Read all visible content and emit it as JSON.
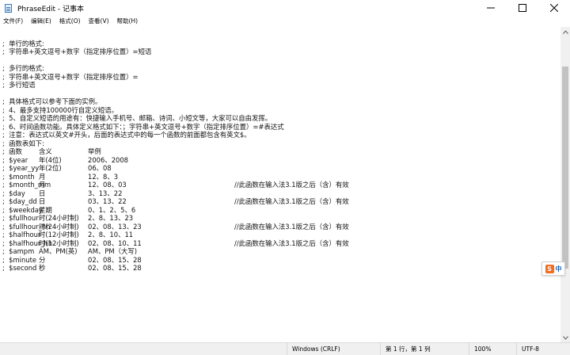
{
  "window": {
    "title": "PhraseEdit - 记事本",
    "controls": [
      "minimize",
      "maximize",
      "close"
    ]
  },
  "menubar": {
    "items": [
      "文件(F)",
      "编辑(E)",
      "格式(O)",
      "查看(V)",
      "帮助(H)"
    ]
  },
  "editor": {
    "lines": [
      [
        ""
      ],
      [
        ";  单行的格式:"
      ],
      [
        ";  字符串+英文逗号+数字（指定排序位置）=短语"
      ],
      [
        ""
      ],
      [
        ";  多行的格式:"
      ],
      [
        ";  字符串+英文逗号+数字（指定排序位置）="
      ],
      [
        ";  多行短语"
      ],
      [
        ""
      ],
      [
        ";  具体格式可以参考下面的实例。"
      ],
      [
        ";  4、最多支持100000行自定义短语。"
      ],
      [
        ";  5、自定义短语的用途有：快捷输入手机号、邮箱、诗词、小短文等，大家可以自由发挥。"
      ],
      [
        ";  6、时间函数功能。具体定义格式如下：；字符串+英文逗号+数字（指定排序位置）=#表达式"
      ],
      [
        ";  注意：表达式以英文#开头，后面的表达式中的每一个函数的前面都包含有英文$。"
      ],
      [
        ";  函数表如下:"
      ],
      [
        ";  函数",
        "含义",
        "举例"
      ],
      [
        ";  $year",
        "年(4位)",
        "2006、2008"
      ],
      [
        ";  $year_yy",
        "年(2位)",
        "06、08"
      ],
      [
        ";  $month",
        "月",
        "12、8、3"
      ],
      [
        ";  $month_mm",
        "月",
        "12、08、03",
        "//此函数在输入法3.1版之后（含）有效"
      ],
      [
        ";  $day",
        "日",
        "3、13、22"
      ],
      [
        ";  $day_dd",
        "日",
        "03、13、22",
        "//此函数在输入法3.1版之后（含）有效"
      ],
      [
        ";  $weekday",
        "星期",
        "0、1、2、5、6"
      ],
      [
        ";  $fullhour",
        "时(24小时制)",
        "2、8、13、23"
      ],
      [
        ";  $fullhour_hh",
        "时(24小时制)",
        "02、08、13、23",
        "//此函数在输入法3.1版之后（含）有效"
      ],
      [
        ";  $halfhour",
        "时(12小时制)",
        "2、8、10、11"
      ],
      [
        ";  $halfhour_hh",
        "时(12小时制)",
        "02、08、10、11",
        "//此函数在输入法3.1版之后（含）有效"
      ],
      [
        ";  $ampm",
        "AM、PM(英)",
        "AM、PM（大写)"
      ],
      [
        ";  $minute",
        "分",
        "02、08、15、28"
      ],
      [
        ";  $second",
        "秒",
        "02、08、15、28"
      ]
    ]
  },
  "statusbar": {
    "encoding": "Windows (CRLF)",
    "position": "第 1 行，第 1 列",
    "zoom": "100%",
    "charset": "UTF-8"
  },
  "ime": {
    "logo": "S",
    "lang": "中"
  },
  "colors": {
    "scroll_thumb": "#c2c2c2",
    "statusbar_bg": "#f0f0f0",
    "ime_accent": "#f26c22"
  }
}
